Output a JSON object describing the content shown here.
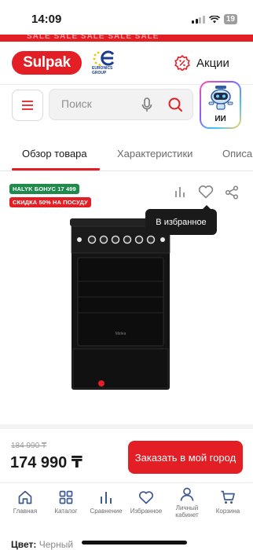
{
  "status": {
    "time": "14:09",
    "battery": "19"
  },
  "promo_banner": "SALE SALE SALE SALE SALE",
  "header": {
    "logo_text": "Sulpak",
    "partner_text": "EURONICS\nGROUP",
    "actions_label": "Акции"
  },
  "search": {
    "placeholder": "Поиск"
  },
  "ai_assistant": {
    "label": "ИИ"
  },
  "tabs": [
    {
      "label": "Обзор товара",
      "active": true
    },
    {
      "label": "Характеристики",
      "active": false
    },
    {
      "label": "Описа",
      "active": false
    }
  ],
  "badges": {
    "halyk": "HALYK БОНУС 17 499",
    "discount": "СКИДКА 50% НА ПОСУДУ"
  },
  "tooltip": "В избранное",
  "product_brand": "Midea",
  "price": {
    "old": "184 990 ₸",
    "current": "174 990 ₸",
    "order_label": "Заказать в мой город"
  },
  "nav": [
    {
      "label": "Главная",
      "icon": "home-icon"
    },
    {
      "label": "Каталог",
      "icon": "grid-icon"
    },
    {
      "label": "Сравнение",
      "icon": "compare-icon"
    },
    {
      "label": "Избранное",
      "icon": "heart-icon"
    },
    {
      "label": "Личный кабинет",
      "icon": "user-icon"
    },
    {
      "label": "Корзина",
      "icon": "cart-icon"
    }
  ],
  "color": {
    "key": "Цвет:",
    "value": "Черный"
  },
  "colors": {
    "brand_red": "#e31e24",
    "badge_green": "#1f8a4c",
    "dark": "#1a1a1a"
  }
}
